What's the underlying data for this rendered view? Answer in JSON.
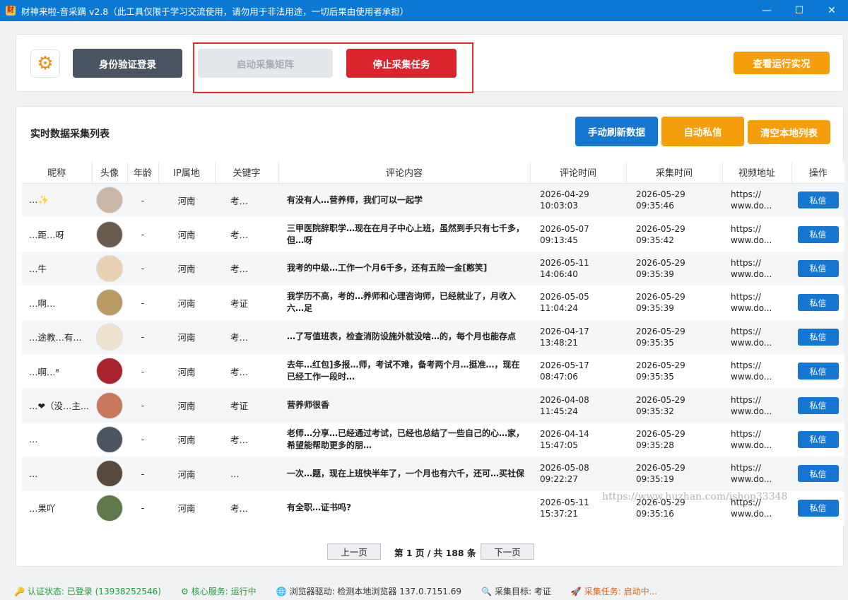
{
  "window": {
    "title": "财神来啦-音采蹒 v2.8（此工具仅限于学习交流使用，请勿用于非法用途，一切后果由使用者承担）",
    "controls": {
      "minimize": "—",
      "maximize": "☐",
      "close": "✕"
    }
  },
  "toolbar": {
    "login_label": "身份验证登录",
    "start_label": "启动采集矩阵",
    "stop_label": "停止采集任务",
    "status_label": "查看运行实况"
  },
  "list": {
    "title": "实时数据采集列表",
    "refresh_label": "手动刷新数据",
    "auto_dm_label": "自动私信",
    "clear_label": "清空本地列表",
    "columns": [
      "昵称",
      "头像",
      "年龄",
      "IP属地",
      "关键字",
      "评论内容",
      "评论时间",
      "采集时间",
      "视频地址",
      "操作"
    ],
    "rows": [
      {
        "nick": "…✨",
        "age": "-",
        "ip": "河南",
        "keyword": "考…",
        "comment": "有没有人…营养师，我们可以一起学",
        "comment_date": "2026-04-29",
        "comment_clock": "10:03:03",
        "collect_date": "2026-05-29",
        "collect_clock": "09:35:46",
        "url1": "https://",
        "url2": "www.do...",
        "action": "私信",
        "avatar_color": "#c9b8a8"
      },
      {
        "nick": "…距…呀",
        "age": "-",
        "ip": "河南",
        "keyword": "考…",
        "comment": "三甲医院辞职学…现在在月子中心上班，虽然到手只有七千多，但…呀",
        "comment_date": "2026-05-07",
        "comment_clock": "09:13:45",
        "collect_date": "2026-05-29",
        "collect_clock": "09:35:42",
        "url1": "https://",
        "url2": "www.do...",
        "action": "私信",
        "avatar_color": "#6b5a4e"
      },
      {
        "nick": "…牛",
        "age": "-",
        "ip": "河南",
        "keyword": "考…",
        "comment": "我考的中级…工作一个月6千多，还有五险一金[憨笑]",
        "comment_date": "2026-05-11",
        "comment_clock": "14:06:40",
        "collect_date": "2026-05-29",
        "collect_clock": "09:35:39",
        "url1": "https://",
        "url2": "www.do...",
        "action": "私信",
        "avatar_color": "#e9d2b4"
      },
      {
        "nick": "…啊…",
        "age": "-",
        "ip": "河南",
        "keyword": "考证",
        "comment": "我学历不高，考的…养师和心理咨询师，已经就业了，月收入六…足",
        "comment_date": "2026-05-05",
        "comment_clock": "11:04:24",
        "collect_date": "2026-05-29",
        "collect_clock": "09:35:39",
        "url1": "https://",
        "url2": "www.do...",
        "action": "私信",
        "avatar_color": "#b89a62"
      },
      {
        "nick": "…途教…有...",
        "age": "-",
        "ip": "河南",
        "keyword": "考…",
        "comment": "…了写值班表，检查消防设施外就没啥…的，每个月也能存点",
        "comment_date": "2026-04-17",
        "comment_clock": "13:48:21",
        "collect_date": "2026-05-29",
        "collect_clock": "09:35:35",
        "url1": "https://",
        "url2": "www.do...",
        "action": "私信",
        "avatar_color": "#efe3cf"
      },
      {
        "nick": "…啊…⁸",
        "age": "-",
        "ip": "河南",
        "keyword": "考…",
        "comment": "去年…红包]多报…师，考试不难，备考两个月…挺准…，现在已经工作一段时…",
        "comment_date": "2026-05-17",
        "comment_clock": "08:47:06",
        "collect_date": "2026-05-29",
        "collect_clock": "09:35:35",
        "url1": "https://",
        "url2": "www.do...",
        "action": "私信",
        "avatar_color": "#a8232b"
      },
      {
        "nick": "…❤（没…主...",
        "age": "-",
        "ip": "河南",
        "keyword": "考证",
        "comment": "营养师很香",
        "comment_date": "2026-04-08",
        "comment_clock": "11:45:24",
        "collect_date": "2026-05-29",
        "collect_clock": "09:35:32",
        "url1": "https://",
        "url2": "www.do...",
        "action": "私信",
        "avatar_color": "#c8785a"
      },
      {
        "nick": "…",
        "age": "-",
        "ip": "河南",
        "keyword": "考…",
        "comment": "老师…分享…已经通过考试，已经也总结了一些自己的心…家，希望能帮助更多的朋…",
        "comment_date": "2026-04-14",
        "comment_clock": "15:47:05",
        "collect_date": "2026-05-29",
        "collect_clock": "09:35:28",
        "url1": "https://",
        "url2": "www.do...",
        "action": "私信",
        "avatar_color": "#4b5563"
      },
      {
        "nick": "…",
        "age": "-",
        "ip": "河南",
        "keyword": "…",
        "comment": "一次…题，现在上班快半年了，一个月也有六千，还可…买社保",
        "comment_date": "2026-05-08",
        "comment_clock": "09:22:27",
        "collect_date": "2026-05-29",
        "collect_clock": "09:35:19",
        "url1": "https://",
        "url2": "www.do...",
        "action": "私信",
        "avatar_color": "#5a4a3c"
      },
      {
        "nick": "…果吖",
        "age": "-",
        "ip": "河南",
        "keyword": "考…",
        "comment": "有全职…证书吗?",
        "comment_date": "2026-05-11",
        "comment_clock": "15:37:21",
        "collect_date": "2026-05-29",
        "collect_clock": "09:35:16",
        "url1": "https://",
        "url2": "www.do...",
        "action": "私信",
        "avatar_color": "#5f7a4a"
      }
    ]
  },
  "pager": {
    "prev_label": "上一页",
    "info": "第 1 页 / 共 188 条",
    "next_label": "下一页"
  },
  "watermark": "https://www.huzhan.com/ishop33348",
  "statusbar": [
    {
      "icon": "🔑",
      "icon_name": "key-icon",
      "text": "认证状态: 已登录 (13938252546)",
      "color": "#1e9e3a"
    },
    {
      "icon": "⚙",
      "icon_name": "service-icon",
      "text": "核心服务: 运行中",
      "color": "#1e9e3a"
    },
    {
      "icon": "🌐",
      "icon_name": "browser-icon",
      "text": "浏览器驱动: 检测本地浏览器 137.0.7151.69",
      "color": "#333333"
    },
    {
      "icon": "🔍",
      "icon_name": "target-icon",
      "text": "采集目标: 考证",
      "color": "#333333"
    },
    {
      "icon": "🚀",
      "icon_name": "rocket-icon",
      "text": "采集任务: 启动中...",
      "color": "#e0641a"
    }
  ]
}
